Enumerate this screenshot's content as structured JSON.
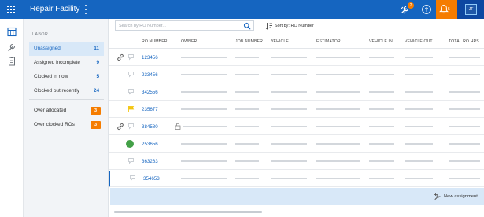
{
  "header": {
    "app_title": "Repair Facility",
    "notification_count": "2",
    "alert_count": "5",
    "user_initials": "JT",
    "colors": {
      "bar": "#1565c0",
      "alert": "#f57c00",
      "avatar_bg": "#0d47a1"
    },
    "icons": [
      "apps-grid-icon",
      "more-vertical-icon",
      "wrench-notification-icon",
      "help-icon",
      "bell-icon"
    ]
  },
  "rail": {
    "icons": [
      "board-icon",
      "wrench-icon",
      "clipboard-icon"
    ]
  },
  "labor": {
    "title": "LABOR",
    "items": [
      {
        "label": "Unassigned",
        "count": "11"
      },
      {
        "label": "Assigned incomplete",
        "count": "9"
      },
      {
        "label": "Clocked in now",
        "count": "5"
      },
      {
        "label": "Clocked out recently",
        "count": "24"
      }
    ],
    "alerts": [
      {
        "label": "Over allocated",
        "count": "3"
      },
      {
        "label": "Over clocked ROs",
        "count": "3"
      }
    ]
  },
  "search": {
    "placeholder": "Search by RO Number...",
    "value": ""
  },
  "sort": {
    "label": "Sort by: RO Number"
  },
  "table": {
    "columns": [
      "RO NUMBER",
      "OWNER",
      "JOB NUMBER",
      "VEHICLE",
      "ESTIMATOR",
      "VEHICLE IN",
      "VEHICLE OUT",
      "TOTAL RO HRS"
    ],
    "rows": [
      {
        "ro": "123456",
        "icons": [
          "link-icon",
          "comment-icon"
        ]
      },
      {
        "ro": "233456",
        "icons": [
          "comment-icon"
        ]
      },
      {
        "ro": "342556",
        "icons": [
          "comment-icon"
        ]
      },
      {
        "ro": "235677",
        "icons": [
          "flag-icon"
        ]
      },
      {
        "ro": "384580",
        "icons": [
          "link-icon",
          "comment-icon",
          "lock-icon"
        ]
      },
      {
        "ro": "253656",
        "icons": [
          "status-dot-icon"
        ]
      },
      {
        "ro": "363263",
        "icons": [
          "comment-icon"
        ]
      },
      {
        "ro": "354653",
        "icons": [
          "comment-icon"
        ]
      }
    ]
  },
  "new_assignment": {
    "label": "New assignment"
  }
}
